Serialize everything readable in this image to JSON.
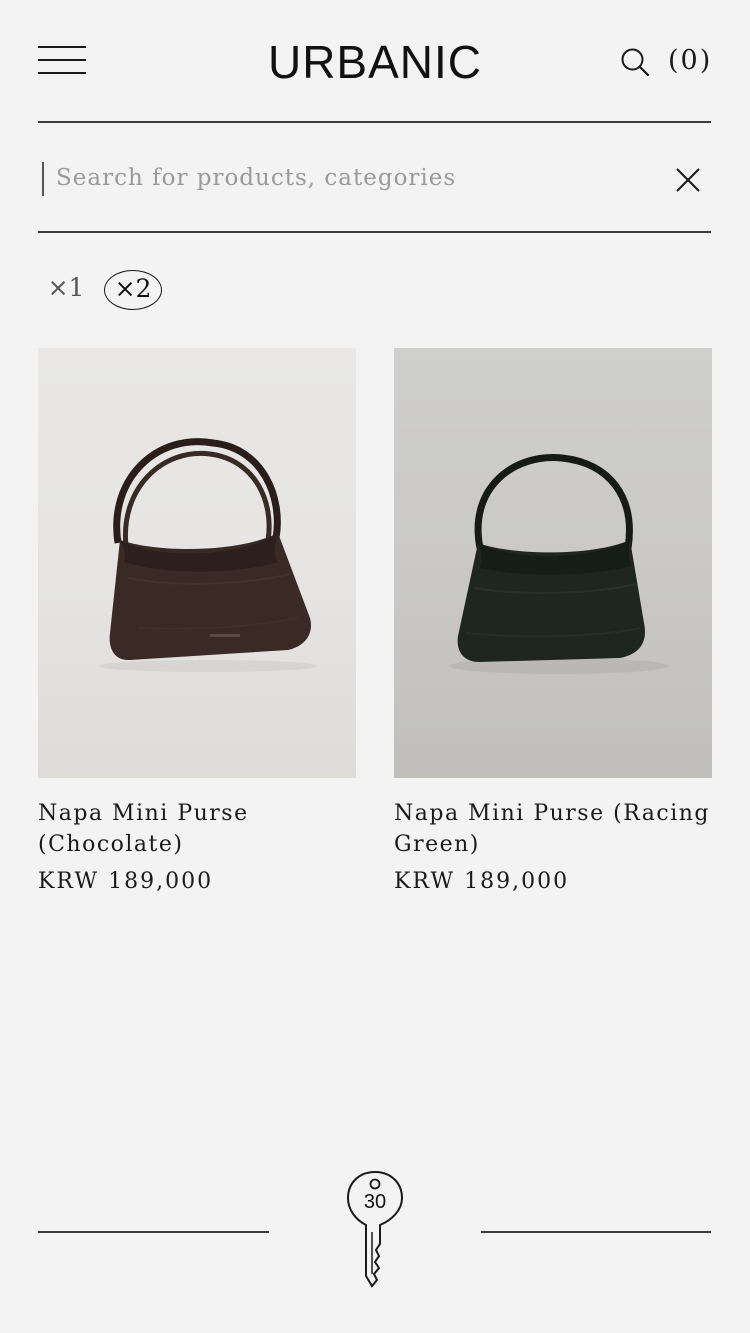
{
  "header": {
    "menu_icon": "hamburger-menu-icon",
    "logo": "URBANIC",
    "search_icon": "search-icon",
    "cart_label": "(0)"
  },
  "search": {
    "placeholder": "Search for products, categories",
    "value": "",
    "clear_icon": "close-icon"
  },
  "view_toggle": {
    "one_column": "×1",
    "two_column": "×2",
    "selected": "two_column"
  },
  "products": [
    {
      "name": "Napa Mini Purse (Chocolate)",
      "price": "KRW 189,000",
      "color": "#3a2a26"
    },
    {
      "name": "Napa Mini Purse (Racing Green)",
      "price": "KRW 189,000",
      "color": "#1f2620"
    }
  ],
  "footer": {
    "key_icon": "key-icon",
    "key_number": "30"
  },
  "colors": {
    "background": "#f3f3f3",
    "text": "#1a1a1a",
    "placeholder": "#9a9a9a"
  }
}
